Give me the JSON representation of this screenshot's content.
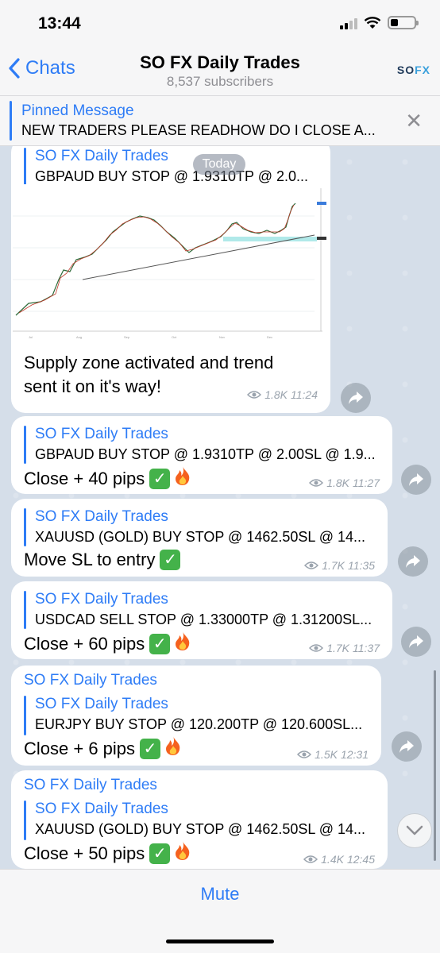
{
  "status": {
    "time": "13:44"
  },
  "nav": {
    "back_label": "Chats",
    "title": "SO FX Daily Trades",
    "subtitle": "8,537 subscribers",
    "logo_left": "SO",
    "logo_right": "FX"
  },
  "pinned": {
    "title": "Pinned Message",
    "text": "NEW TRADERS PLEASE READHOW DO I CLOSE A..."
  },
  "date_badge": "Today",
  "messages": [
    {
      "fw_name": "SO FX Daily Trades",
      "fw_text": "GBPAUD BUY STOP @ 1.9310TP @ 2.0...",
      "text1": "Supply zone activated and trend",
      "text2": "sent it on it's way!",
      "views": "1.8K",
      "time": "11:24"
    },
    {
      "fw_name": "SO FX Daily Trades",
      "fw_text": "GBPAUD BUY STOP @ 1.9310TP @ 2.00SL @ 1.9...",
      "text": "Close + 40 pips",
      "views": "1.8K",
      "time": "11:27"
    },
    {
      "fw_name": "SO FX Daily Trades",
      "fw_text": "XAUUSD (GOLD) BUY STOP @ 1462.50SL @ 14...",
      "text": "Move SL to entry",
      "views": "1.7K",
      "time": "11:35"
    },
    {
      "fw_name": "SO FX Daily Trades",
      "fw_text": "USDCAD SELL STOP @ 1.33000TP @ 1.31200SL...",
      "text": "Close + 60 pips",
      "views": "1.7K",
      "time": "11:37"
    },
    {
      "name": "SO FX Daily Trades",
      "fw_name": "SO FX Daily Trades",
      "fw_text": "EURJPY BUY STOP @ 120.200TP @ 120.600SL...",
      "text": "Close + 6 pips",
      "views": "1.5K",
      "time": "12:31"
    },
    {
      "name": "SO FX Daily Trades",
      "fw_name": "SO FX Daily Trades",
      "fw_text": "XAUUSD (GOLD) BUY STOP @ 1462.50SL @ 14...",
      "text": "Close + 50 pips",
      "views": "1.4K",
      "time": "12:45"
    }
  ],
  "bottom": {
    "mute_label": "Mute"
  },
  "icons": {
    "check": "white-heavy-check-mark-icon",
    "fire": "fire-icon",
    "share": "share-icon",
    "views": "eye-icon"
  },
  "colors": {
    "accent": "#2e7cf6",
    "chat_bg": "#d5dee9",
    "check_green": "#44b24a"
  }
}
